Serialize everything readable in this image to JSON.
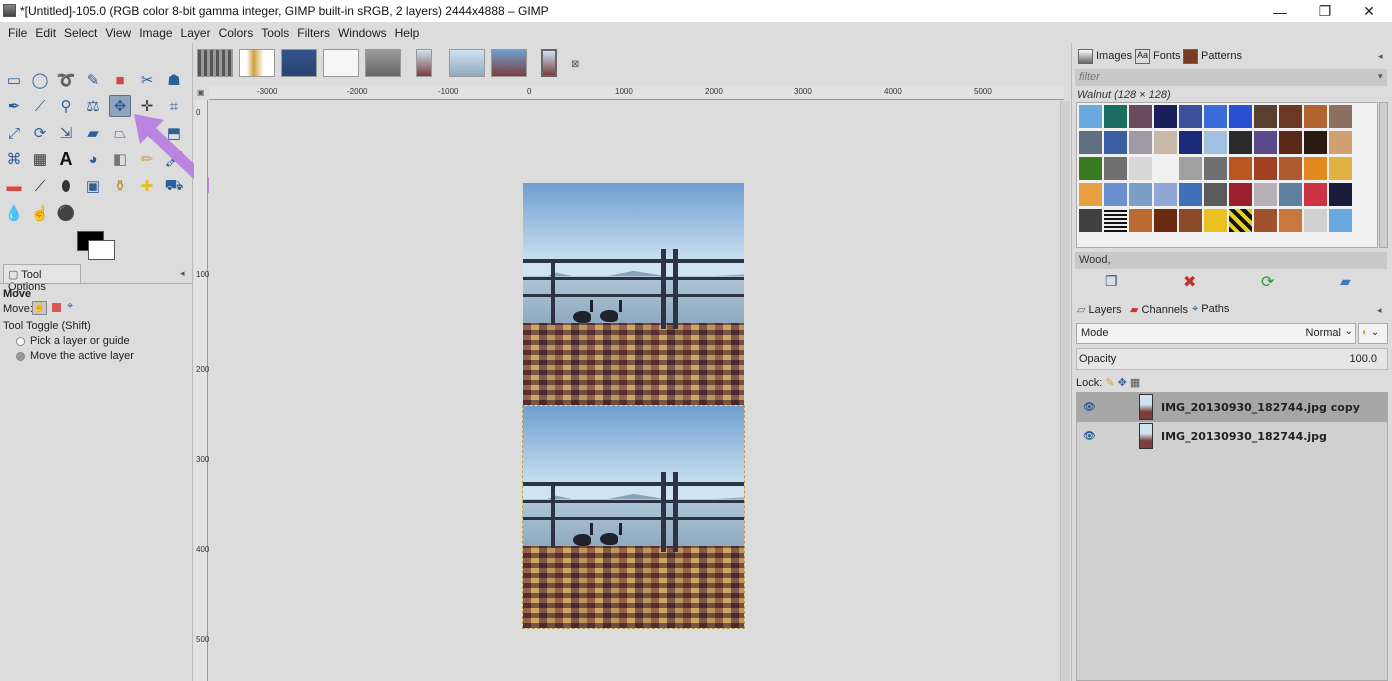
{
  "window": {
    "title": "*[Untitled]-105.0 (RGB color 8-bit gamma integer, GIMP built-in sRGB, 2 layers) 2444x4888 – GIMP",
    "minimize": "—",
    "maximize": "❐",
    "close": "✕"
  },
  "menu": [
    "File",
    "Edit",
    "Select",
    "View",
    "Image",
    "Layer",
    "Colors",
    "Tools",
    "Filters",
    "Windows",
    "Help"
  ],
  "tool_options": {
    "tab_label": "Tool Options",
    "tool_name": "Move",
    "move_label": "Move:",
    "toggle_label": "Tool Toggle  (Shift)",
    "option1": "Pick a layer or guide",
    "option2": "Move the active layer"
  },
  "rulers": {
    "h_ticks": [
      "-3000",
      "-2000",
      "-1000",
      "0",
      "1000",
      "2000",
      "3000",
      "4000",
      "5000"
    ],
    "v_ticks": [
      "0",
      "1000",
      "2000",
      "3000",
      "4000",
      "5000"
    ]
  },
  "right_panel": {
    "tabs": [
      "Images",
      "Fonts",
      "Patterns"
    ],
    "filter_placeholder": "filter",
    "pattern_name": "Walnut (128 × 128)",
    "brush_name": "Wood,",
    "layer_tabs": [
      "Layers",
      "Channels",
      "Paths"
    ],
    "mode_label": "Mode",
    "mode_value": "Normal",
    "opacity_label": "Opacity",
    "opacity_value": "100.0",
    "lock_label": "Lock:",
    "layers": [
      {
        "name": "IMG_20130930_182744.jpg copy",
        "selected": true
      },
      {
        "name": "IMG_20130930_182744.jpg",
        "selected": false
      }
    ]
  },
  "colors": {
    "accent_arrow": "#b77fe0",
    "selection_border": "#b9a447"
  }
}
